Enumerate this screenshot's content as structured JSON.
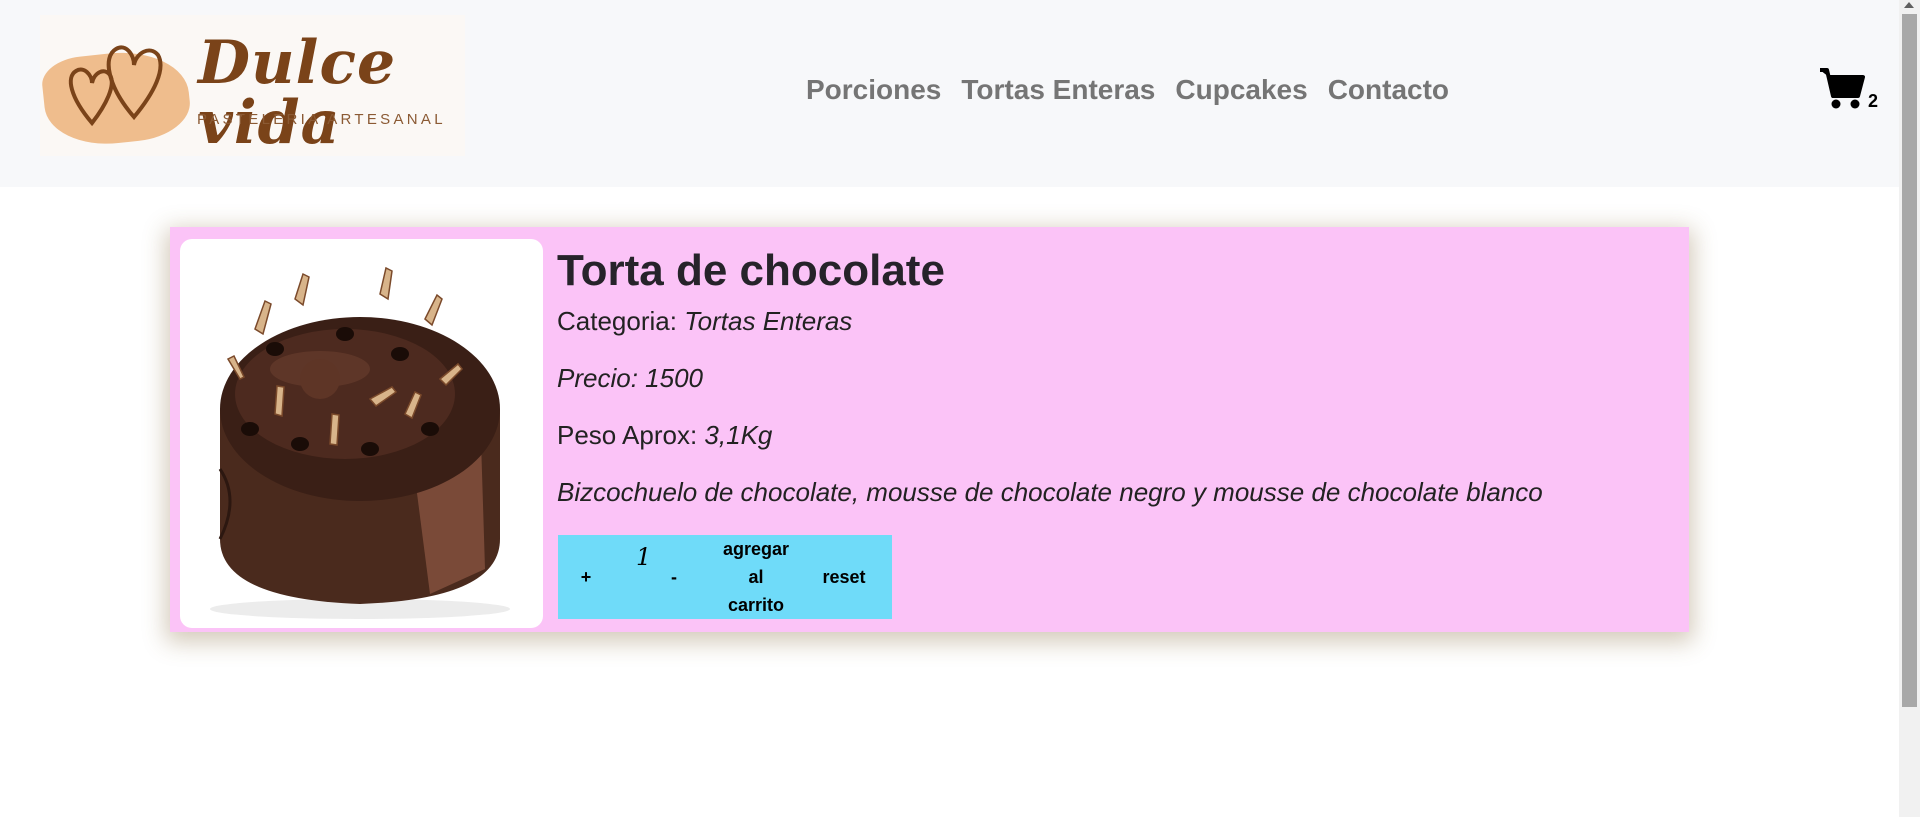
{
  "header": {
    "logo": {
      "title": "Dulce vida",
      "subtitle": "PASTELERIA ARTESANAL"
    },
    "nav": [
      {
        "label": "Porciones"
      },
      {
        "label": "Tortas Enteras"
      },
      {
        "label": "Cupcakes"
      },
      {
        "label": "Contacto"
      }
    ],
    "cart": {
      "icon": "shopping-cart-icon",
      "count": "2"
    }
  },
  "product": {
    "title": "Torta de chocolate",
    "category_label": "Categoria: ",
    "category_value": "Tortas Enteras",
    "price_label": "Precio: ",
    "price_value": "1500",
    "weight_label": "Peso Aprox: ",
    "weight_value": "3,1Kg",
    "description": "Bizcochuelo de chocolate, mousse de chocolate negro y mousse de chocolate blanco",
    "image_icon": "chocolate-cake-image",
    "controls": {
      "plus": "+",
      "quantity": "1",
      "minus": "-",
      "add_line1": "agregar",
      "add_line2": "al",
      "add_line3": "carrito",
      "reset": "reset"
    }
  },
  "colors": {
    "navbar_bg": "#f7f8fa",
    "card_bg": "#fbc3f7",
    "controls_bg": "#6fdbf9",
    "nav_text": "#757575",
    "logo_brown": "#7a4319",
    "logo_peach": "#efbd8d"
  }
}
